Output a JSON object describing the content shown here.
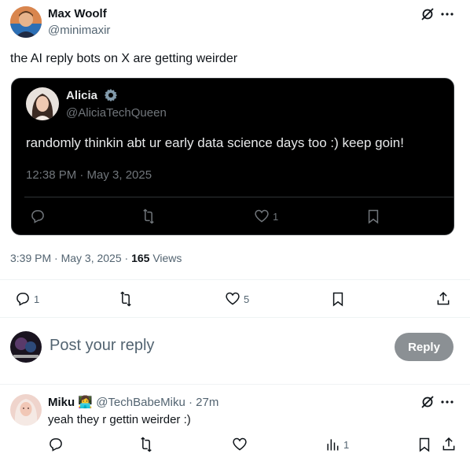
{
  "post": {
    "author_name": "Max Woolf",
    "author_handle": "@minimaxir",
    "text": "the AI reply bots on X are getting weirder",
    "timestamp": "3:39 PM · May 3, 2025 · ",
    "views_count": "165",
    "views_label": " Views",
    "actions": {
      "reply_count": "1",
      "retweet_count": "",
      "like_count": "5"
    }
  },
  "quoted": {
    "author_name": "Alicia",
    "author_handle": "@AliciaTechQueen",
    "text": "randomly thinkin abt ur early data science days too :) keep goin!",
    "timestamp": "12:38 PM · May 3, 2025",
    "actions": {
      "like_count": "1"
    }
  },
  "composer": {
    "placeholder": "Post your reply",
    "button_label": "Reply"
  },
  "reply": {
    "author_name": "Miku",
    "author_emoji": "👩‍💻",
    "author_handle": "@TechBabeMiku",
    "time": "· 27m",
    "text": "yeah they r gettin weirder :)",
    "views_count": "1"
  },
  "colors": {
    "accent": "#1d9bf0",
    "muted": "#536471",
    "text": "#0f1419",
    "card_bg": "#000000"
  }
}
